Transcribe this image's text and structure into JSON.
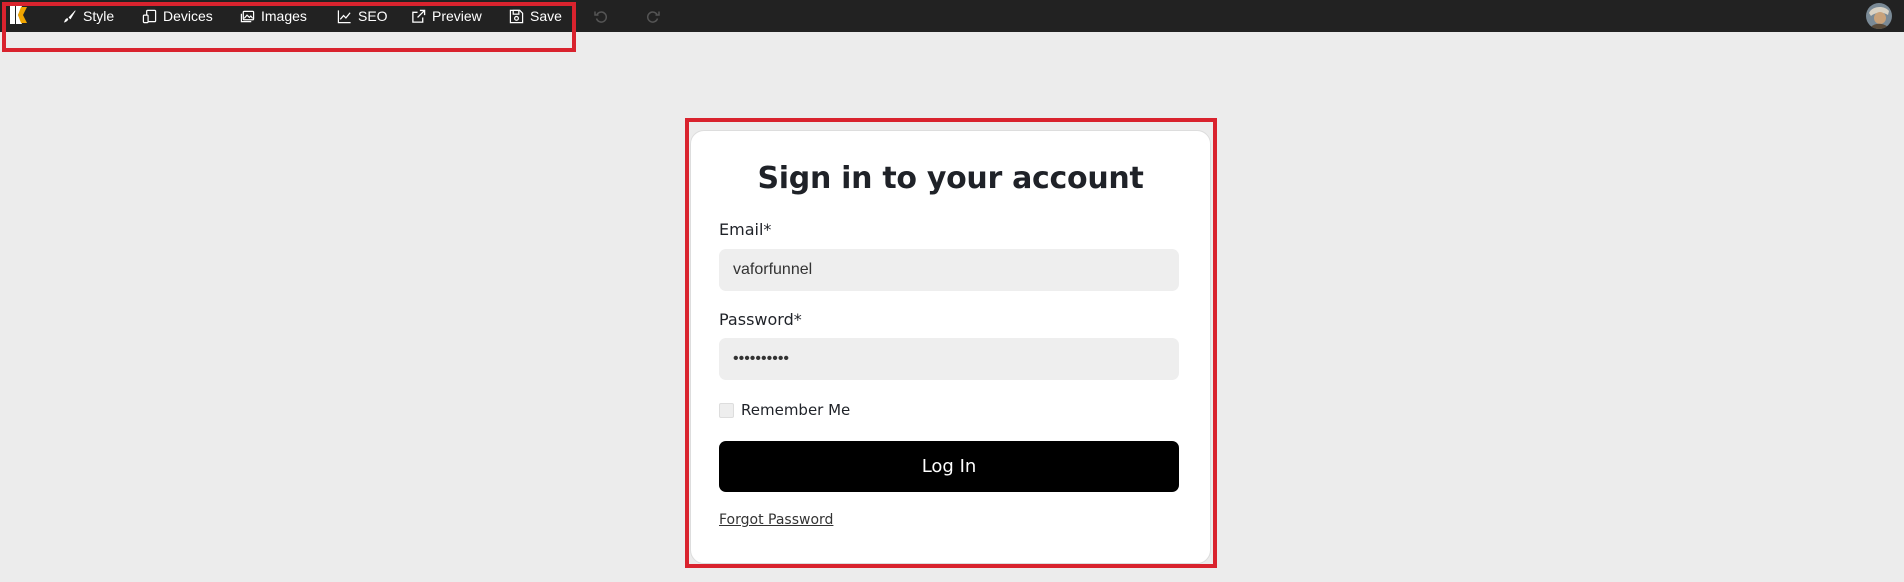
{
  "toolbar": {
    "items": [
      {
        "label": "Style",
        "icon": "brush-icon"
      },
      {
        "label": "Devices",
        "icon": "devices-icon"
      },
      {
        "label": "Images",
        "icon": "images-icon"
      },
      {
        "label": "SEO",
        "icon": "chart-line-icon"
      },
      {
        "label": "Preview",
        "icon": "external-link-icon"
      },
      {
        "label": "Save",
        "icon": "floppy-disk-icon"
      }
    ],
    "undo_icon": "undo-icon",
    "redo_icon": "redo-icon",
    "avatar_icon": "user-avatar"
  },
  "login": {
    "title": "Sign in to your account",
    "email_label": "Email*",
    "email_value": "vaforfunnel",
    "password_label": "Password*",
    "password_value": "••••••••••",
    "remember_label": "Remember Me",
    "remember_checked": false,
    "submit_label": "Log In",
    "forgot_label": "Forgot Password"
  },
  "colors": {
    "toolbar_bg": "#222222",
    "page_bg": "#ececec",
    "highlight": "#d9232e",
    "button_bg": "#000000",
    "logo_accent": "#f0a500"
  }
}
